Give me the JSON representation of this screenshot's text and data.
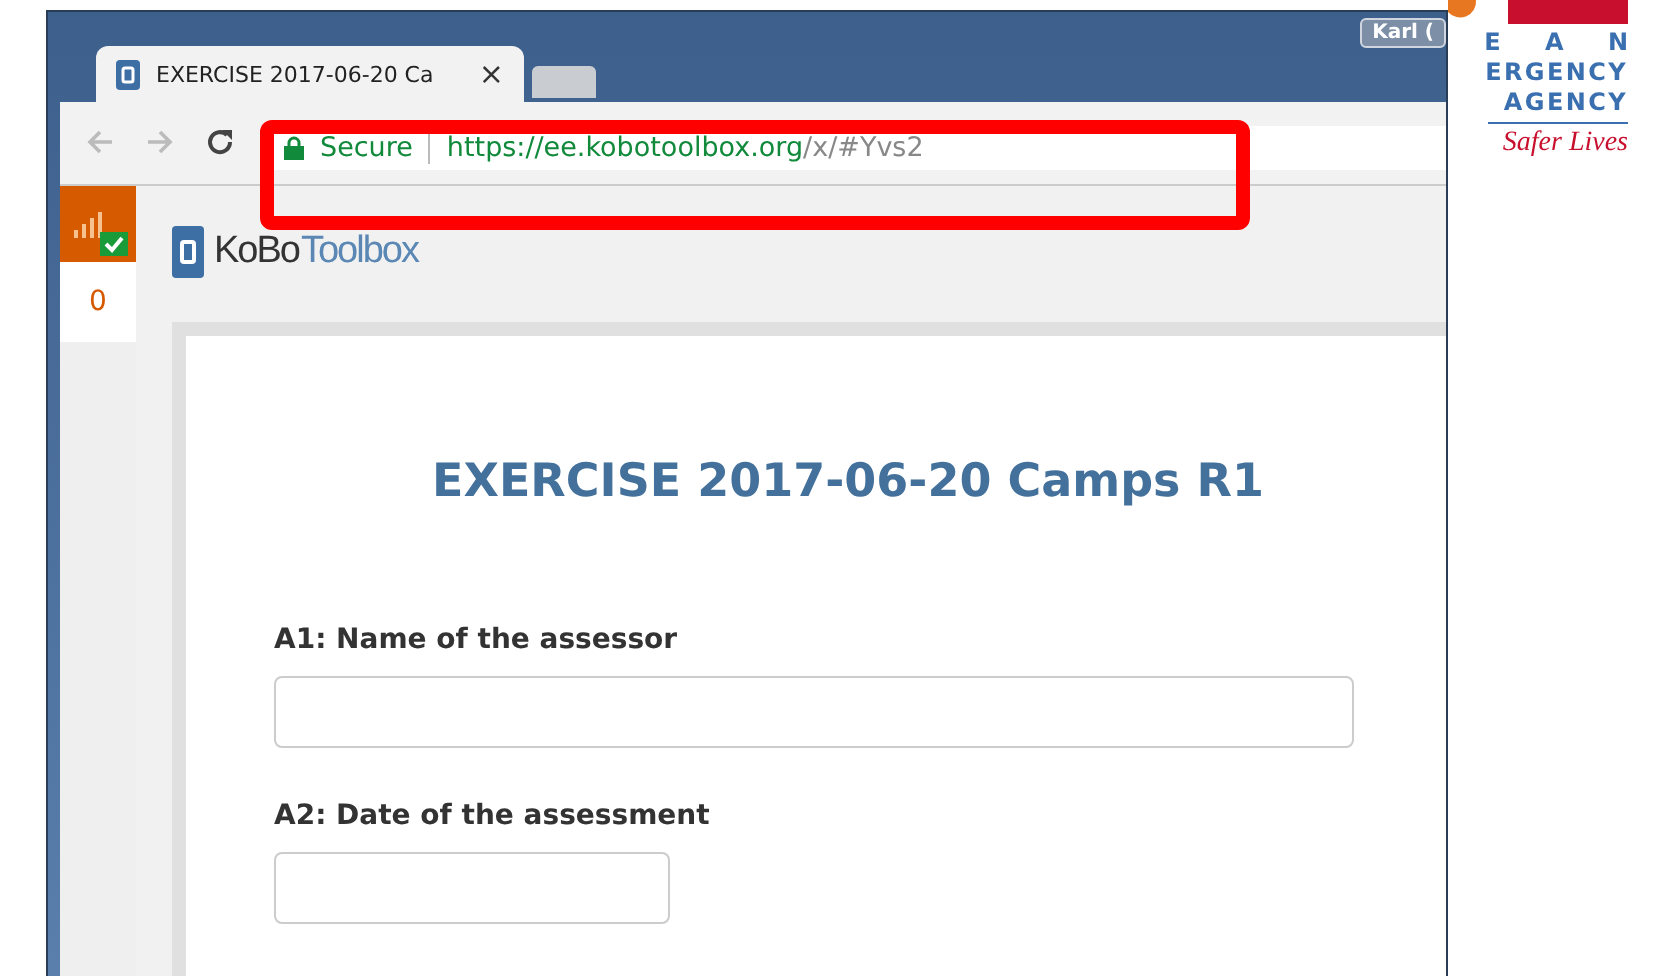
{
  "browser": {
    "tab": {
      "title": "EXERCISE 2017-06-20 Ca",
      "close": "×"
    },
    "user_button": "Karl (",
    "address": {
      "security": "Secure",
      "url_host": "https://ee.kobotoolbox.org",
      "url_path": "/x/#Yvs2"
    }
  },
  "extension": {
    "count": "0"
  },
  "brand": {
    "name_first": "KoBo",
    "name_second": "Toolbox"
  },
  "form": {
    "title": "EXERCISE 2017-06-20 Camps R1",
    "questions": [
      {
        "label": "A1: Name of the assessor",
        "kind": "text"
      },
      {
        "label": "A2: Date of the assessment",
        "kind": "date"
      }
    ]
  },
  "logo": {
    "lines": [
      "E A N",
      "ERGENCY",
      "AGENCY"
    ],
    "tagline": "Safer Lives"
  }
}
